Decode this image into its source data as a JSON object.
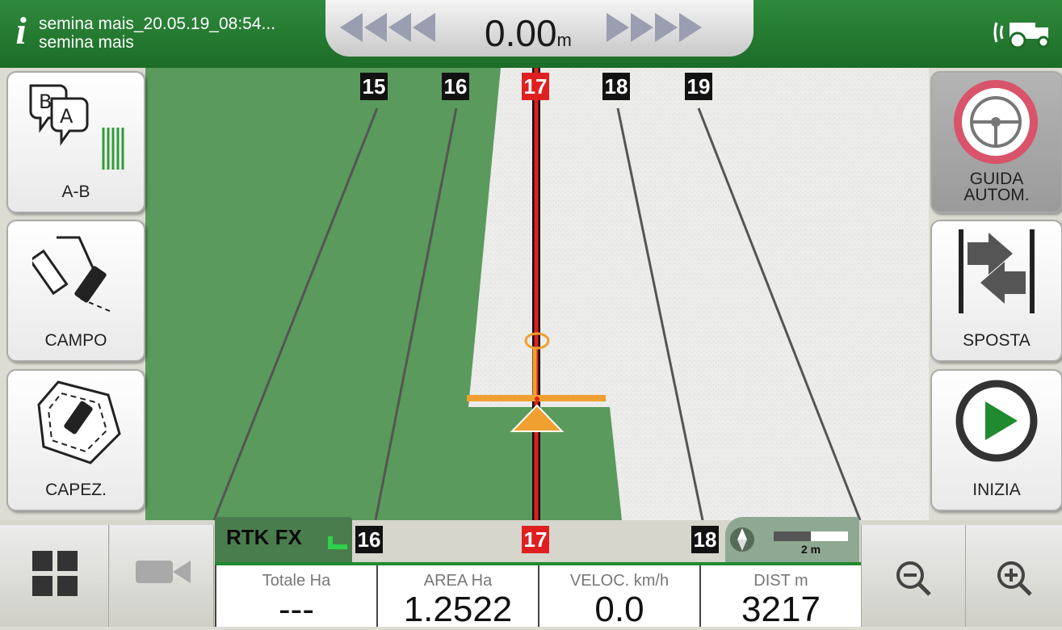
{
  "header": {
    "job_name": "semina mais_20.05.19_08:54...",
    "job_subtitle": "semina mais",
    "info_icon": "info-icon",
    "signal_icon": "tractor-signal-icon"
  },
  "lightbar": {
    "offset_value": "0.00",
    "offset_unit": "m"
  },
  "left_buttons": [
    {
      "label": "A-B",
      "icon": "ab-line-icon"
    },
    {
      "label": "CAMPO",
      "icon": "field-draw-icon"
    },
    {
      "label": "CAPEZ.",
      "icon": "headland-icon"
    }
  ],
  "right_buttons": [
    {
      "label": "GUIDA\nAUTOM.",
      "icon": "steering-wheel-icon"
    },
    {
      "label": "SPOSTA",
      "icon": "shift-line-icon"
    },
    {
      "label": "INIZIA",
      "icon": "play-icon"
    }
  ],
  "guidance_lines": {
    "top": [
      "15",
      "16",
      "17",
      "18",
      "19"
    ],
    "bottom": [
      "16",
      "17",
      "18"
    ],
    "active": "17"
  },
  "gps": {
    "status": "RTK FX"
  },
  "scale": {
    "label": "2 m"
  },
  "stats": [
    {
      "title": "Totale Ha",
      "value": "---"
    },
    {
      "title": "AREA Ha",
      "value": "1.2522"
    },
    {
      "title": "VELOC. km/h",
      "value": "0.0"
    },
    {
      "title": "DIST m",
      "value": "3217"
    }
  ],
  "bottom_buttons": {
    "menu_icon": "grid-menu-icon",
    "camera_icon": "camera-icon",
    "zoom_out_icon": "zoom-out-icon",
    "zoom_in_icon": "zoom-in-icon"
  },
  "colors": {
    "header_green": "#1f7a2e",
    "field_green": "#5a9a5c",
    "worked_area": "#ececec",
    "active_line": "#e02020",
    "tractor": "#f0a030"
  }
}
